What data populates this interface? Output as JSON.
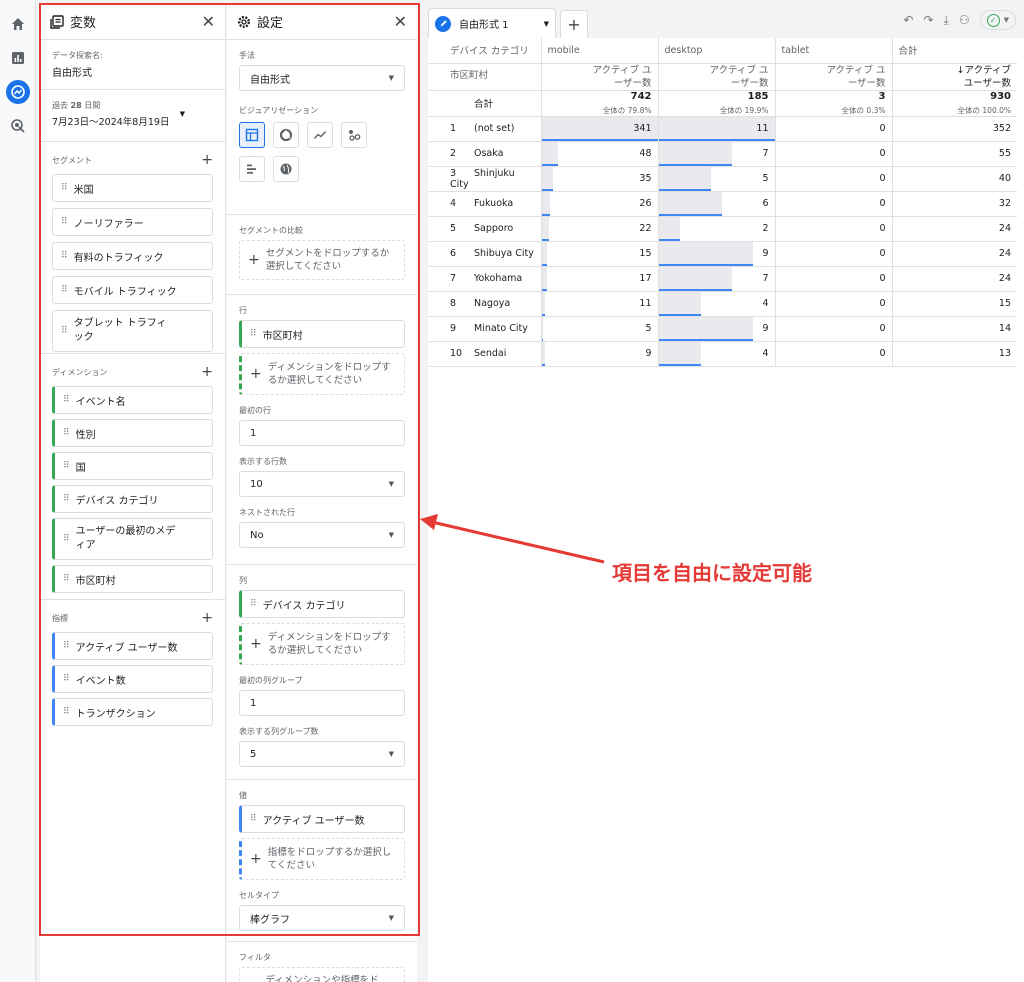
{
  "var_panel": {
    "title": "変数",
    "explore_name_label": "データ探索名:",
    "explore_name": "自由形式",
    "date_prefix": "過去",
    "date_days": "28",
    "date_suffix": "日間",
    "date_range": "7月23日～2024年8月19日",
    "segments_label": "セグメント",
    "segments": [
      "米国",
      "ノーリファラー",
      "有料のトラフィック",
      "モバイル トラフィック",
      "タブレット トラフィック"
    ],
    "dimensions_label": "ディメンション",
    "dimensions": [
      "イベント名",
      "性別",
      "国",
      "デバイス カテゴリ",
      "ユーザーの最初のメディア",
      "市区町村"
    ],
    "metrics_label": "指標",
    "metrics": [
      "アクティブ ユーザー数",
      "イベント数",
      "トランザクション"
    ]
  },
  "set_panel": {
    "title": "設定",
    "technique_label": "手法",
    "technique": "自由形式",
    "viz_label": "ビジュアリゼーション",
    "segment_compare_label": "セグメントの比較",
    "segment_drop": "セグメントをドロップするか選択してください",
    "rows_label": "行",
    "row_dim": "市区町村",
    "row_drop": "ディメンションをドロップするか選択してください",
    "first_row_label": "最初の行",
    "first_row": "1",
    "show_rows_label": "表示する行数",
    "show_rows": "10",
    "nested_label": "ネストされた行",
    "nested": "No",
    "cols_label": "列",
    "col_dim": "デバイス カテゴリ",
    "col_drop": "ディメンションをドロップするか選択してください",
    "first_col_label": "最初の列グループ",
    "first_col": "1",
    "show_cols_label": "表示する列グループ数",
    "show_cols": "5",
    "values_label": "値",
    "value_metric": "アクティブ ユーザー数",
    "value_drop": "指標をドロップするか選択してください",
    "cell_type_label": "セルタイプ",
    "cell_type": "棒グラフ",
    "filter_label": "フィルタ",
    "filter_drop": "ディメンションや指標をド"
  },
  "canvas": {
    "tab_label": "自由形式 1",
    "dim_header": "デバイス カテゴリ",
    "row_header": "市区町村",
    "columns": [
      "mobile",
      "desktop",
      "tablet",
      "合計"
    ],
    "metric_header": "アクティブ ユーザー数",
    "metric_header_sorted": "↓アクティブ ユーザー数",
    "total_label": "合計",
    "totals": [
      "742",
      "185",
      "3",
      "930"
    ],
    "total_pcts": [
      "全体の 79.8%",
      "全体の 19.9%",
      "全体の 0.3%",
      "全体の 100.0%"
    ],
    "rows": [
      {
        "n": "1",
        "city": "(not set)",
        "mobile": "341",
        "desktop": "11",
        "tablet": "0",
        "total": "352"
      },
      {
        "n": "2",
        "city": "Osaka",
        "mobile": "48",
        "desktop": "7",
        "tablet": "0",
        "total": "55"
      },
      {
        "n": "3",
        "city": "Shinjuku City",
        "mobile": "35",
        "desktop": "5",
        "tablet": "0",
        "total": "40"
      },
      {
        "n": "4",
        "city": "Fukuoka",
        "mobile": "26",
        "desktop": "6",
        "tablet": "0",
        "total": "32"
      },
      {
        "n": "5",
        "city": "Sapporo",
        "mobile": "22",
        "desktop": "2",
        "tablet": "0",
        "total": "24"
      },
      {
        "n": "6",
        "city": "Shibuya City",
        "mobile": "15",
        "desktop": "9",
        "tablet": "0",
        "total": "24"
      },
      {
        "n": "7",
        "city": "Yokohama",
        "mobile": "17",
        "desktop": "7",
        "tablet": "0",
        "total": "24"
      },
      {
        "n": "8",
        "city": "Nagoya",
        "mobile": "11",
        "desktop": "4",
        "tablet": "0",
        "total": "15"
      },
      {
        "n": "9",
        "city": "Minato City",
        "mobile": "5",
        "desktop": "9",
        "tablet": "0",
        "total": "14"
      },
      {
        "n": "10",
        "city": "Sendai",
        "mobile": "9",
        "desktop": "4",
        "tablet": "0",
        "total": "13"
      }
    ]
  },
  "annotation": "項目を自由に設定可能",
  "colors": {
    "accent": "#1a73e8",
    "highlight": "#e53935",
    "dimension": "#34a853",
    "metric": "#4285f4"
  }
}
